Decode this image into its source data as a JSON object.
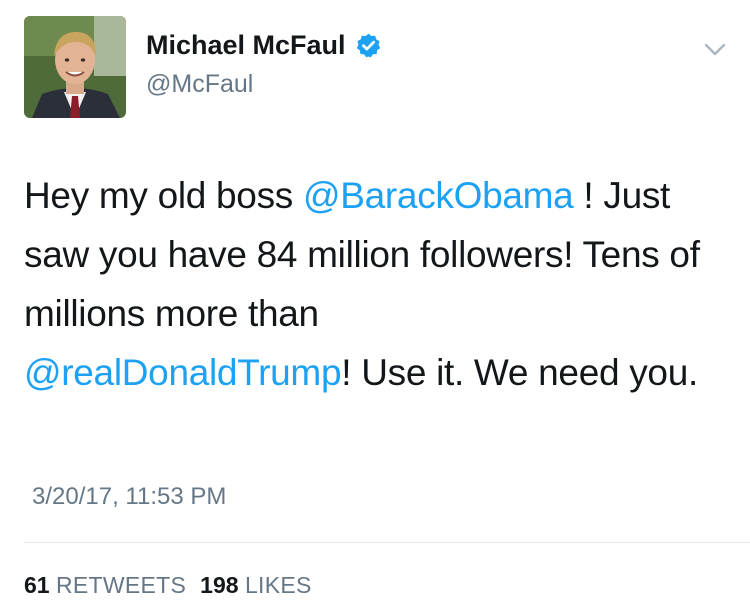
{
  "author": {
    "display_name": "Michael McFaul",
    "handle": "@McFaul",
    "verified": true,
    "avatar_icon": "profile-photo"
  },
  "tweet": {
    "text_part1": "Hey my old boss ",
    "mention1": "@BarackObama",
    "text_part2": " ! Just saw you have 84 million followers! Tens of millions more than ",
    "mention2": "@realDonaldTrump",
    "text_part3": "! Use it. We need you.",
    "timestamp": "3/20/17, 11:53 PM"
  },
  "stats": {
    "retweets_count": "61",
    "retweets_label": "RETWEETS",
    "likes_count": "198",
    "likes_label": "LIKES"
  },
  "colors": {
    "link": "#1da1f2",
    "text": "#14171a",
    "secondary": "#657786",
    "divider": "#e1e8ed"
  },
  "icons": {
    "verified": "verified-badge-icon",
    "menu": "chevron-down-icon"
  }
}
